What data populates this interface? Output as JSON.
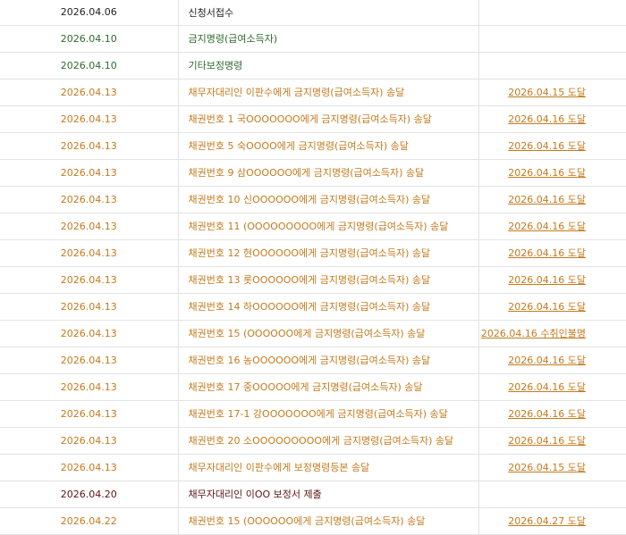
{
  "colors": {
    "black": "#222222",
    "green": "#2f6a2f",
    "orange": "#c47a1d",
    "maroon": "#5a1414"
  },
  "rows": [
    {
      "date": "2026.04.06",
      "desc": "신청서접수",
      "result": "",
      "color": "black"
    },
    {
      "date": "2026.04.10",
      "desc": "금지명령(급여소득자)",
      "result": "",
      "color": "green"
    },
    {
      "date": "2026.04.10",
      "desc": "기타보정명령",
      "result": "",
      "color": "green"
    },
    {
      "date": "2026.04.13",
      "desc": "채무자대리인 이판수에게 금지명령(급여소득자) 송달",
      "result": "2026.04.15 도달",
      "color": "orange"
    },
    {
      "date": "2026.04.13",
      "desc": "채권번호 1 국OOOOOOO에게 금지명령(급여소득자) 송달",
      "result": "2026.04.16 도달",
      "color": "orange"
    },
    {
      "date": "2026.04.13",
      "desc": "채권번호 5 숙OOOO에게 금지명령(급여소득자) 송달",
      "result": "2026.04.16 도달",
      "color": "orange"
    },
    {
      "date": "2026.04.13",
      "desc": "채권번호 9 삼OOOOOO에게 금지명령(급여소득자) 송달",
      "result": "2026.04.16 도달",
      "color": "orange"
    },
    {
      "date": "2026.04.13",
      "desc": "채권번호 10 신OOOOOO에게 금지명령(급여소득자) 송달",
      "result": "2026.04.16 도달",
      "color": "orange"
    },
    {
      "date": "2026.04.13",
      "desc": "채권번호 11 (OOOOOOOOO에게 금지명령(급여소득자) 송달",
      "result": "2026.04.16 도달",
      "color": "orange"
    },
    {
      "date": "2026.04.13",
      "desc": "채권번호 12 현OOOOOO에게 금지명령(급여소득자) 송달",
      "result": "2026.04.16 도달",
      "color": "orange"
    },
    {
      "date": "2026.04.13",
      "desc": "채권번호 13 롯OOOOOO에게 금지명령(급여소득자) 송달",
      "result": "2026.04.16 도달",
      "color": "orange"
    },
    {
      "date": "2026.04.13",
      "desc": "채권번호 14 하OOOOOO에게 금지명령(급여소득자) 송달",
      "result": "2026.04.16 도달",
      "color": "orange"
    },
    {
      "date": "2026.04.13",
      "desc": "채권번호 15 (OOOOOO에게 금지명령(급여소득자) 송달",
      "result": "2026.04.16 수취인불명",
      "color": "orange"
    },
    {
      "date": "2026.04.13",
      "desc": "채권번호 16 농OOOOOO에게 금지명령(급여소득자) 송달",
      "result": "2026.04.16 도달",
      "color": "orange"
    },
    {
      "date": "2026.04.13",
      "desc": "채권번호 17 중OOOOO에게 금지명령(급여소득자) 송달",
      "result": "2026.04.16 도달",
      "color": "orange"
    },
    {
      "date": "2026.04.13",
      "desc": "채권번호 17-1 강OOOOOOO에게 금지명령(급여소득자) 송달",
      "result": "2026.04.16 도달",
      "color": "orange"
    },
    {
      "date": "2026.04.13",
      "desc": "채권번호 20 소OOOOOOOOO에게 금지명령(급여소득자) 송달",
      "result": "2026.04.16 도달",
      "color": "orange"
    },
    {
      "date": "2026.04.13",
      "desc": "채무자대리인 이판수에게 보정명령등본 송달",
      "result": "2026.04.15 도달",
      "color": "orange"
    },
    {
      "date": "2026.04.20",
      "desc": "채무자대리인 이OO 보정서 제출",
      "result": "",
      "color": "maroon"
    },
    {
      "date": "2026.04.22",
      "desc": "채권번호 15 (OOOOOO에게 금지명령(급여소득자) 송달",
      "result": "2026.04.27 도달",
      "color": "orange"
    }
  ]
}
